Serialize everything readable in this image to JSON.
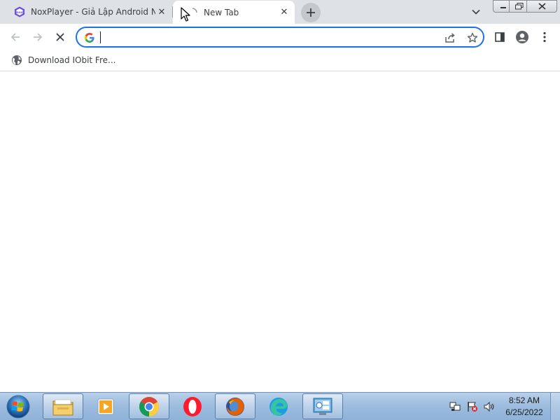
{
  "tabs": [
    {
      "title": "NoxPlayer - Giả Lập Android Nha",
      "favicon": "noxplayer-icon",
      "active": false
    },
    {
      "title": "New Tab",
      "favicon": "loading-spinner-icon",
      "active": true
    }
  ],
  "tabstrip": {
    "new_tab_icon": "plus-icon",
    "tab_search_icon": "chevron-down-icon"
  },
  "window_controls": [
    "minimize-icon",
    "maximize-icon",
    "close-icon"
  ],
  "toolbar": {
    "back_icon": "arrow-left-icon",
    "forward_icon": "arrow-right-icon",
    "stop_icon": "stop-loading-icon",
    "omnibox": {
      "value": "",
      "placeholder": "",
      "engine_icon": "google-g-icon"
    },
    "share_icon": "share-icon",
    "bookmark_star_icon": "star-icon",
    "side_panel_icon": "side-panel-icon",
    "profile_icon": "profile-icon",
    "menu_icon": "more-vert-icon"
  },
  "bookmarks": [
    {
      "label": "Download IObit Fre...",
      "icon": "globe-icon"
    }
  ],
  "taskbar": {
    "items": [
      {
        "name": "file-explorer",
        "icon": "folder-icon",
        "state": "running"
      },
      {
        "name": "media-player",
        "icon": "media-player-icon",
        "state": "pinned"
      },
      {
        "name": "chrome",
        "icon": "chrome-icon",
        "state": "running"
      },
      {
        "name": "opera",
        "icon": "opera-icon",
        "state": "pinned"
      },
      {
        "name": "firefox",
        "icon": "firefox-icon",
        "state": "running"
      },
      {
        "name": "edge",
        "icon": "edge-icon",
        "state": "pinned"
      },
      {
        "name": "control-panel",
        "icon": "control-panel-icon",
        "state": "running"
      }
    ],
    "tray": [
      "network-icon",
      "flag-warning-icon",
      "volume-icon"
    ],
    "clock": {
      "time": "8:52 AM",
      "date": "6/25/2022"
    }
  },
  "colors": {
    "tabstrip_bg": "#dee1e6",
    "omnibox_border": "#1a73e8",
    "taskbar_bg": "#9ebddf"
  }
}
